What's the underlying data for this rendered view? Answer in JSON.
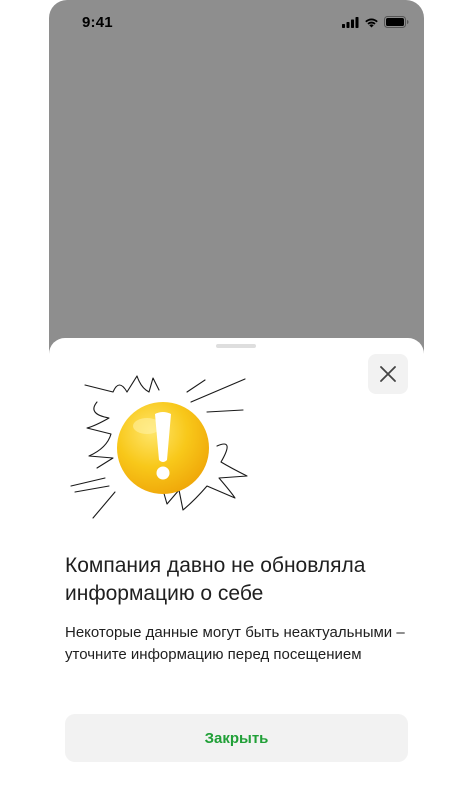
{
  "status_bar": {
    "time": "9:41",
    "icons": [
      "signal-icon",
      "wifi-icon",
      "battery-icon"
    ]
  },
  "sheet": {
    "close_icon": "close-icon",
    "illustration_icon": "warning-exclamation-icon",
    "title": "Компания давно не обновляла информацию о себе",
    "subtitle": "Некоторые данные могут быть неактуальными – уточните информацию перед посещением",
    "button_label": "Закрыть"
  },
  "colors": {
    "backdrop": "#8e8e8e",
    "accent_green": "#21a038",
    "button_bg": "#f2f2f2",
    "warning_yellow": "#f5c518"
  }
}
